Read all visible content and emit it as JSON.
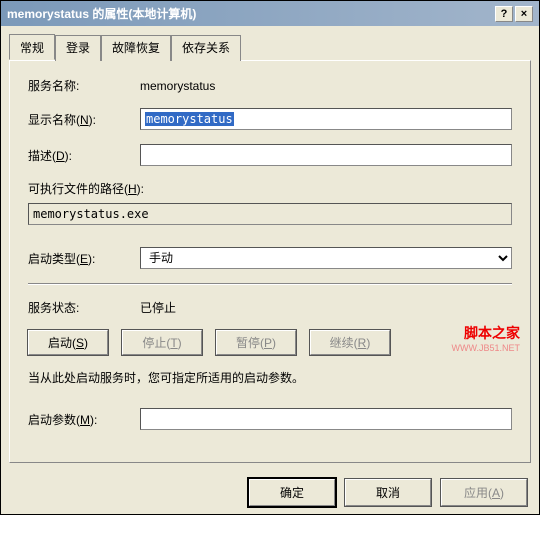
{
  "title": "memorystatus 的属性(本地计算机)",
  "titlebar": {
    "help": "?",
    "close": "×"
  },
  "tabs": {
    "general": "常规",
    "logon": "登录",
    "recovery": "故障恢复",
    "dependency": "依存关系"
  },
  "general": {
    "service_name_label": "服务名称:",
    "service_name_value": "memorystatus",
    "display_name_label_pre": "显示名称(",
    "display_name_key": "N",
    "display_name_label_post": "):",
    "display_name_value": "memorystatus",
    "desc_label_pre": "描述(",
    "desc_key": "D",
    "desc_label_post": "):",
    "desc_value": "",
    "exec_path_label_pre": "可执行文件的路径(",
    "exec_path_key": "H",
    "exec_path_label_post": "):",
    "exec_path_value": "memorystatus.exe",
    "startup_type_label_pre": "启动类型(",
    "startup_type_key": "E",
    "startup_type_label_post": "):",
    "startup_type_value": "手动",
    "status_label": "服务状态:",
    "status_value": "已停止",
    "start_btn_pre": "启动(",
    "start_btn_key": "S",
    "start_btn_post": ")",
    "stop_btn_pre": "停止(",
    "stop_btn_key": "T",
    "stop_btn_post": ")",
    "pause_btn_pre": "暂停(",
    "pause_btn_key": "P",
    "pause_btn_post": ")",
    "resume_btn_pre": "继续(",
    "resume_btn_key": "R",
    "resume_btn_post": ")",
    "hint": "当从此处启动服务时，您可指定所适用的启动参数。",
    "start_params_label_pre": "启动参数(",
    "start_params_key": "M",
    "start_params_label_post": "):",
    "start_params_value": ""
  },
  "footer": {
    "ok": "确定",
    "cancel": "取消",
    "apply_pre": "应用(",
    "apply_key": "A",
    "apply_post": ")"
  },
  "watermark": {
    "line1": "脚本之家",
    "line2": "WWW.JB51.NET"
  }
}
